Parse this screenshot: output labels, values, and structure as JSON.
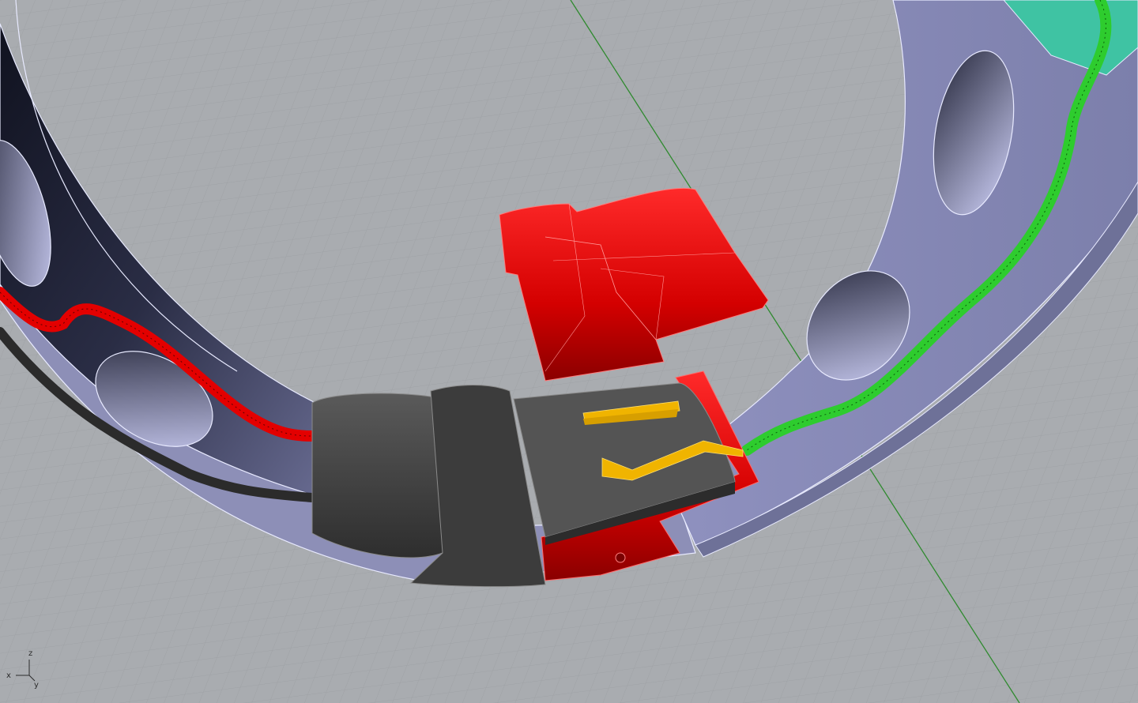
{
  "viewport": {
    "view_name": "Perspective",
    "axes": {
      "x_label": "x",
      "y_label": "y",
      "z_label": "z"
    }
  },
  "colors": {
    "background": "#a9acb0",
    "grid_line": "#9da0a4",
    "ring_face": "#9a9cc4",
    "ring_edge": "#e8eaff",
    "selection_red": "#e30000",
    "cable_green": "#2ecc2e",
    "contact_yellow": "#f0b400",
    "connector_body": "#4a4a4a",
    "world_axis_green": "#2f8a2f"
  },
  "objects": [
    {
      "name": "ring-housing",
      "selected": false
    },
    {
      "name": "red-cap-part",
      "selected": true
    },
    {
      "name": "connector-body",
      "selected": false
    },
    {
      "name": "red-cable",
      "selected": true
    },
    {
      "name": "green-cable",
      "selected": false
    },
    {
      "name": "contact-pins",
      "selected": false
    }
  ]
}
